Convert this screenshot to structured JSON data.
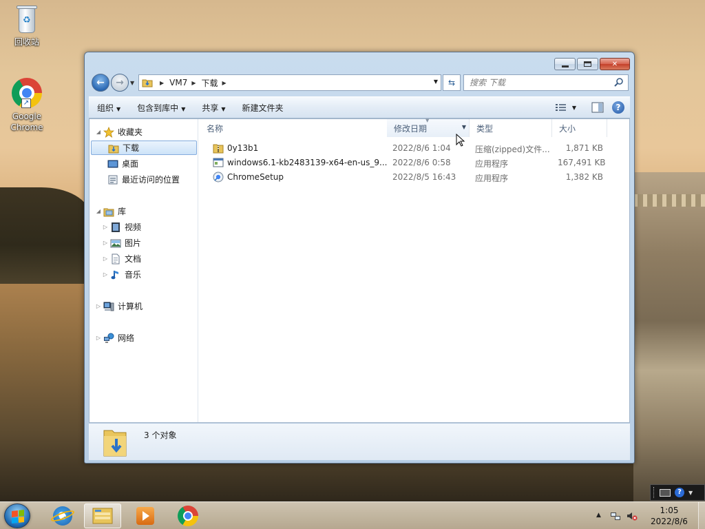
{
  "desktop": {
    "icons": [
      {
        "label": "回收站",
        "icon": "recycle-bin-icon"
      },
      {
        "label": "Google Chrome",
        "icon": "chrome-icon"
      }
    ]
  },
  "window": {
    "caption_buttons": {
      "minimize": "minimize",
      "maximize": "maximize",
      "close": "✕"
    },
    "address": {
      "crumbs": [
        "VM7",
        "下载"
      ]
    },
    "search": {
      "placeholder": "搜索 下载"
    },
    "toolbar": {
      "items": [
        "组织",
        "包含到库中",
        "共享",
        "新建文件夹"
      ]
    },
    "nav": {
      "favorites": {
        "label": "收藏夹",
        "items": [
          "下载",
          "桌面",
          "最近访问的位置"
        ]
      },
      "libraries": {
        "label": "库",
        "items": [
          "视频",
          "图片",
          "文档",
          "音乐"
        ]
      },
      "computer": "计算机",
      "network": "网络",
      "selected": "下载"
    },
    "columns": [
      "名称",
      "修改日期",
      "类型",
      "大小"
    ],
    "sorted_column": "修改日期",
    "files": [
      {
        "name": "0y13b1",
        "date": "2022/8/6 1:04",
        "type": "压缩(zipped)文件...",
        "size": "1,871 KB",
        "icon": "zip-folder-icon"
      },
      {
        "name": "windows6.1-kb2483139-x64-en-us_9...",
        "date": "2022/8/6 0:58",
        "type": "应用程序",
        "size": "167,491 KB",
        "icon": "exe-icon"
      },
      {
        "name": "ChromeSetup",
        "date": "2022/8/5 16:43",
        "type": "应用程序",
        "size": "1,382 KB",
        "icon": "chrome-setup-icon"
      }
    ],
    "status": {
      "count": "3 个对象"
    }
  },
  "taskbar": {
    "apps": [
      "internet-explorer",
      "windows-explorer",
      "media-player",
      "google-chrome"
    ],
    "active_app": "windows-explorer",
    "clock": {
      "time": "1:05",
      "date": "2022/8/6"
    }
  },
  "colors": {
    "accent": "#2c6ab5",
    "selection": "#cde3f8",
    "header_text": "#4c607a"
  }
}
